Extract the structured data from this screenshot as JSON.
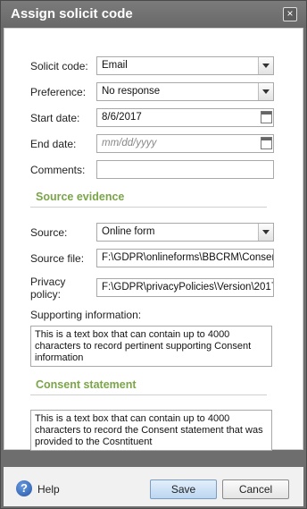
{
  "dialog": {
    "title": "Assign solicit code",
    "close_glyph": "×"
  },
  "form": {
    "solicit_code_label": "Solicit code:",
    "solicit_code_value": "Email",
    "preference_label": "Preference:",
    "preference_value": "No response",
    "start_date_label": "Start date:",
    "start_date_value": "8/6/2017",
    "end_date_label": "End date:",
    "end_date_placeholder": "mm/dd/yyyy",
    "comments_label": "Comments:",
    "comments_value": ""
  },
  "source_evidence": {
    "heading": "Source evidence",
    "source_label": "Source:",
    "source_value": "Online form",
    "source_file_label": "Source file:",
    "source_file_value": "F:\\GDPR\\onlineforms\\BBCRM\\Consent",
    "privacy_policy_label_1": "Privacy",
    "privacy_policy_label_2": "policy:",
    "privacy_policy_value": "F:\\GDPR\\privacyPolicies\\Version\\2017",
    "supporting_info_label": "Supporting information:",
    "supporting_info_value": "This is a text box that can contain up to 4000 characters to record pertinent supporting Consent information"
  },
  "consent_statement": {
    "heading": "Consent statement",
    "value": "This is a text box that can contain up to 4000 characters to record the Consent statement that was provided to the Cosntituent"
  },
  "footer": {
    "help_icon_glyph": "?",
    "help_label": "Help",
    "save_label": "Save",
    "cancel_label": "Cancel"
  },
  "colors": {
    "section_heading": "#7aa548",
    "titlebar": "#6e6e6e",
    "primary_button": "#bcd6f0"
  }
}
